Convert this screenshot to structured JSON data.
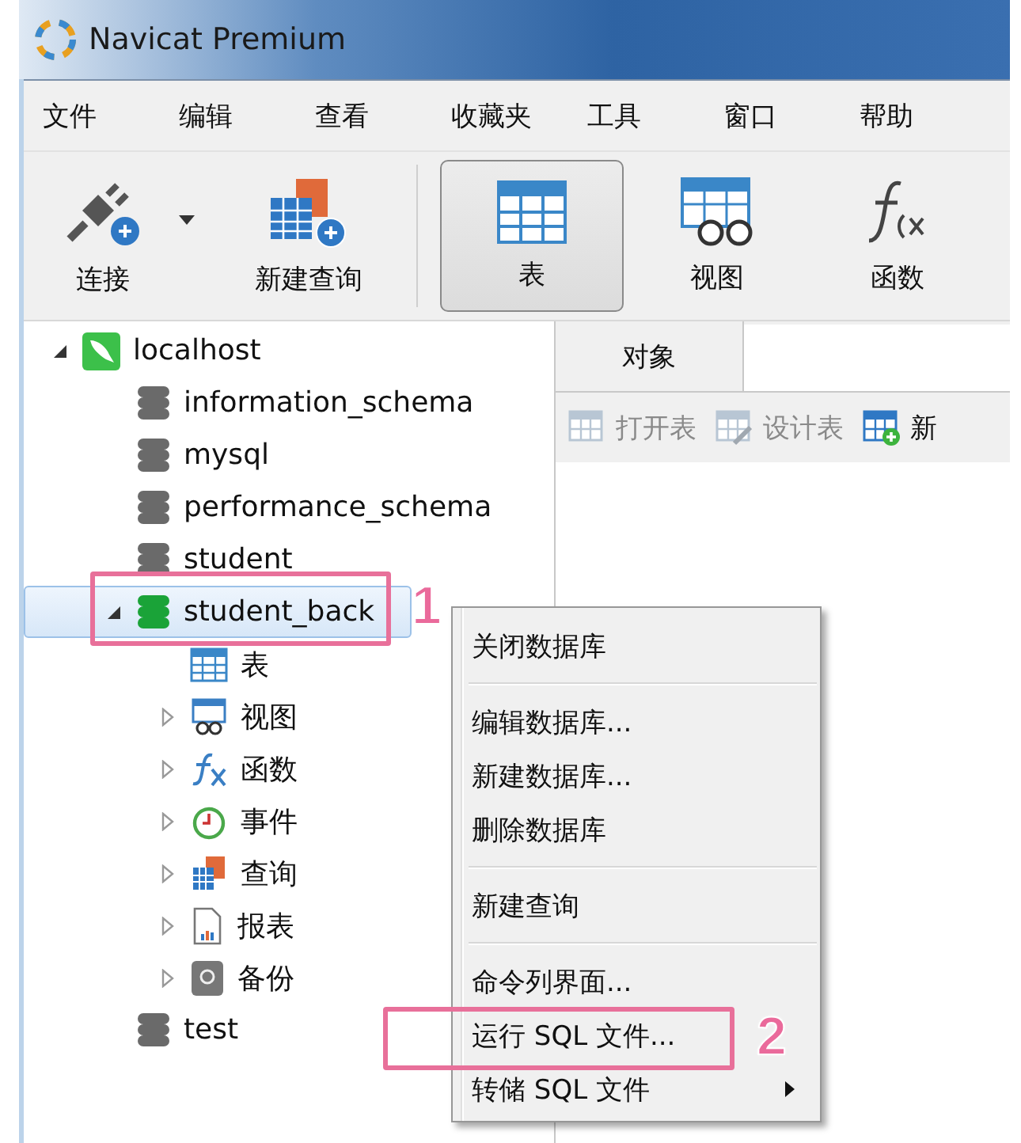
{
  "window": {
    "title": "Navicat Premium"
  },
  "menu": [
    "文件",
    "编辑",
    "查看",
    "收藏夹",
    "工具",
    "窗口",
    "帮助"
  ],
  "toolbar": [
    {
      "label": "连接",
      "kind": "connect",
      "dropdown": true,
      "selected": false
    },
    {
      "label": "新建查询",
      "kind": "query",
      "dropdown": false,
      "selected": false
    },
    {
      "label": "表",
      "kind": "table",
      "dropdown": false,
      "selected": true
    },
    {
      "label": "视图",
      "kind": "view",
      "dropdown": false,
      "selected": false
    },
    {
      "label": "函数",
      "kind": "function",
      "dropdown": false,
      "selected": false
    }
  ],
  "tree": [
    {
      "label": "localhost",
      "kind": "connection",
      "expanded": true,
      "selected": false,
      "children": [
        {
          "label": "information_schema",
          "kind": "database",
          "open": false,
          "selected": false
        },
        {
          "label": "mysql",
          "kind": "database",
          "open": false,
          "selected": false
        },
        {
          "label": "performance_schema",
          "kind": "database",
          "open": false,
          "selected": false
        },
        {
          "label": "student",
          "kind": "database",
          "open": false,
          "selected": false
        },
        {
          "label": "student_back",
          "kind": "database",
          "open": true,
          "expanded": true,
          "selected": true,
          "children": [
            {
              "label": "表",
              "kind": "table",
              "selected": false
            },
            {
              "label": "视图",
              "kind": "view",
              "expanded": false,
              "selected": false
            },
            {
              "label": "函数",
              "kind": "function",
              "expanded": false,
              "selected": false
            },
            {
              "label": "事件",
              "kind": "event",
              "expanded": false,
              "selected": false
            },
            {
              "label": "查询",
              "kind": "query",
              "expanded": false,
              "selected": false
            },
            {
              "label": "报表",
              "kind": "report",
              "expanded": false,
              "selected": false
            },
            {
              "label": "备份",
              "kind": "backup",
              "expanded": false,
              "selected": false
            }
          ]
        },
        {
          "label": "test",
          "kind": "database",
          "open": false,
          "selected": false
        }
      ]
    }
  ],
  "object_tabs": [
    {
      "label": "对象",
      "selected": true
    }
  ],
  "object_actions": [
    {
      "label": "打开表",
      "kind": "open-table",
      "disabled": true
    },
    {
      "label": "设计表",
      "kind": "design-table",
      "disabled": true
    },
    {
      "label": "新",
      "kind": "new-table",
      "disabled": false
    }
  ],
  "context_menu": [
    [
      {
        "label": "关闭数据库",
        "submenu": false
      }
    ],
    [
      {
        "label": "编辑数据库...",
        "submenu": false
      },
      {
        "label": "新建数据库...",
        "submenu": false
      },
      {
        "label": "删除数据库",
        "submenu": false
      }
    ],
    [
      {
        "label": "新建查询",
        "submenu": false
      }
    ],
    [
      {
        "label": "命令列界面...",
        "submenu": false
      },
      {
        "label": "运行 SQL 文件...",
        "submenu": false
      },
      {
        "label": "转储 SQL 文件",
        "submenu": true
      }
    ]
  ],
  "callouts": [
    {
      "label": "1"
    },
    {
      "label": "2"
    }
  ]
}
